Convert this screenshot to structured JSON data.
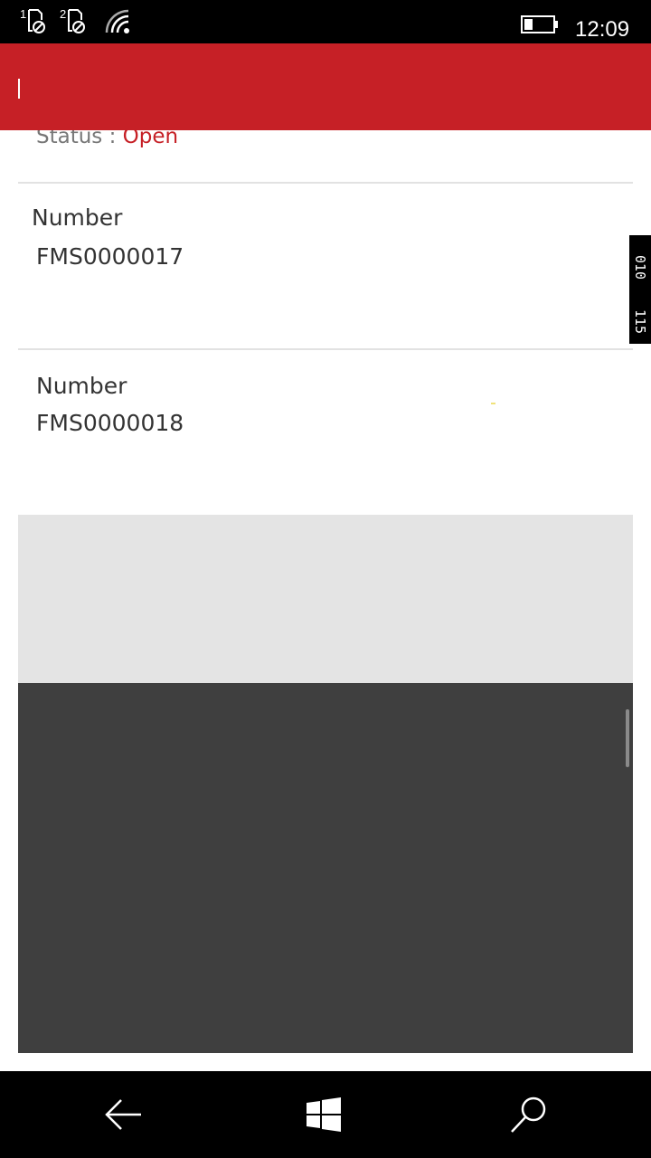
{
  "status_bar": {
    "sim1": "1",
    "sim2": "2",
    "time": "12:09",
    "battery_level": 0.3,
    "icons": [
      "sim-blocked-icon",
      "sim-blocked-icon",
      "wifi-icon",
      "battery-icon"
    ]
  },
  "header": {
    "accent_color": "#c62026"
  },
  "list": {
    "partial_status": {
      "label": "Status : ",
      "value": "Open"
    },
    "items": [
      {
        "label": "Number",
        "value": "FMS0000017"
      },
      {
        "label": "Number",
        "value": "FMS0000018"
      }
    ]
  },
  "debug_counter": {
    "line1": "010",
    "line2": "115"
  },
  "nav_bar": {
    "icons": [
      "back-arrow-icon",
      "windows-logo-icon",
      "search-icon"
    ]
  }
}
